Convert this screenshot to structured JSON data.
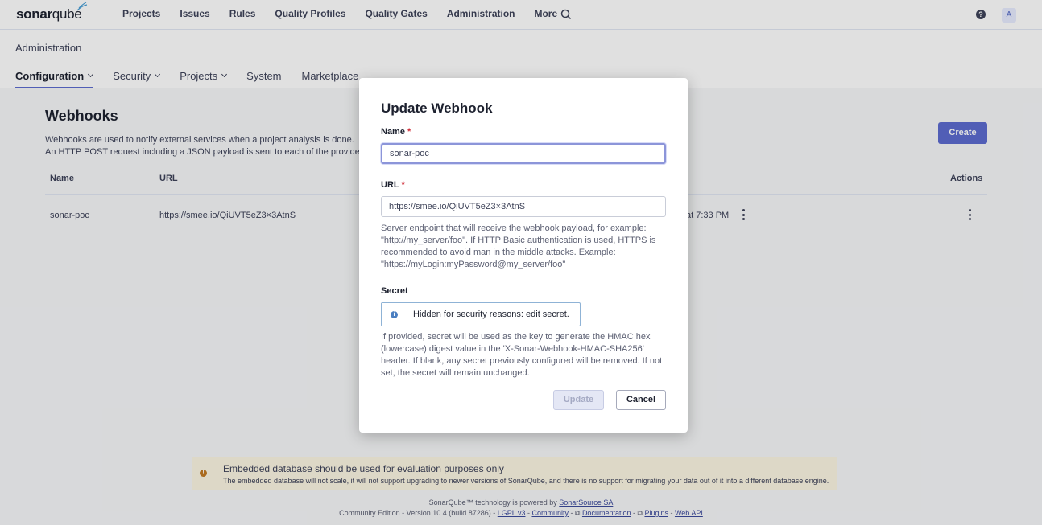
{
  "topnav": {
    "logo_bold": "sonar",
    "logo_light": "qube",
    "items": [
      "Projects",
      "Issues",
      "Rules",
      "Quality Profiles",
      "Quality Gates",
      "Administration",
      "More"
    ],
    "search_icon": "search-icon",
    "help_icon": "?",
    "avatar": "A"
  },
  "admin": {
    "title": "Administration",
    "tabs": [
      "Configuration",
      "Security",
      "Projects",
      "System",
      "Marketplace"
    ]
  },
  "webhooks": {
    "title": "Webhooks",
    "desc_line1": "Webhooks are used to notify external services when a project analysis is done.",
    "desc_line2": "An HTTP POST request including a JSON payload is sent to each of the provide",
    "create_label": "Create",
    "columns": {
      "name": "Name",
      "url": "URL",
      "actions": "Actions"
    },
    "rows": [
      {
        "name": "sonar-poc",
        "url": "https://smee.io/QiUVT5eZ3×3AtnS",
        "last_delivery": "at 7:33 PM"
      }
    ]
  },
  "banner": {
    "title": "Embedded database should be used for evaluation purposes only",
    "text": "The embedded database will not scale, it will not support upgrading to newer versions of SonarQube, and there is no support for migrating your data out of it into a different database engine."
  },
  "footer": {
    "line1_prefix": "SonarQube™ technology is powered by",
    "line1_link": "SonarSource SA",
    "edition": "Community Edition - Version 10.4 (build 87286) -",
    "links": [
      "LGPL v3",
      "Community",
      "Documentation",
      "Plugins",
      "Web API"
    ]
  },
  "modal": {
    "title": "Update Webhook",
    "name_label": "Name",
    "name_value": "sonar-poc",
    "url_label": "URL",
    "url_value": "https://smee.io/QiUVT5eZ3×3AtnS",
    "url_help": "Server endpoint that will receive the webhook payload, for example: \"http://my_server/foo\". If HTTP Basic authentication is used, HTTPS is recommended to avoid man in the middle attacks. Example: \"https://myLogin:myPassword@my_server/foo\"",
    "secret_label": "Secret",
    "secret_hidden_text": "Hidden for security reasons:",
    "secret_edit_link": "edit secret",
    "secret_help": "If provided, secret will be used as the key to generate the HMAC hex (lowercase) digest value in the 'X-Sonar-Webhook-HMAC-SHA256' header. If blank, any secret previously configured will be removed. If not set, the secret will remain unchanged.",
    "update_label": "Update",
    "cancel_label": "Cancel",
    "required_mark": "*"
  }
}
